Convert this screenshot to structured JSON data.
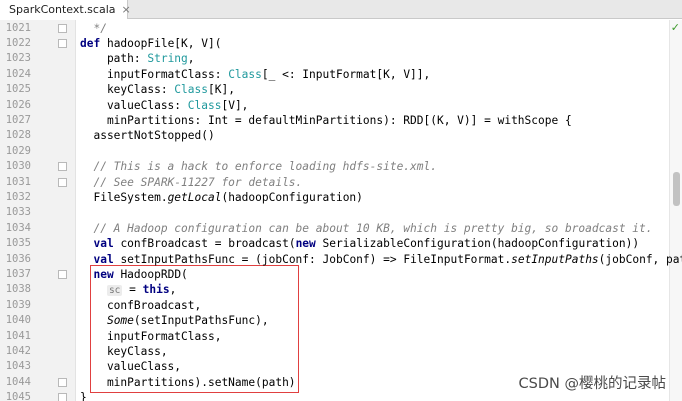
{
  "editor": {
    "tab": {
      "filename": "SparkContext.scala",
      "close": "×"
    },
    "status_check": "✓",
    "watermark": "CSDN @樱桃的记录帖"
  },
  "lines": [
    {
      "n": "1021",
      "fold": true,
      "segs": [
        {
          "t": "  */",
          "c": "cm"
        }
      ]
    },
    {
      "n": "1022",
      "fold": true,
      "segs": [
        {
          "t": "def",
          "c": "kw"
        },
        {
          "t": " hadoopFile[K, V]("
        }
      ]
    },
    {
      "n": "1023",
      "fold": false,
      "segs": [
        {
          "t": "    path: "
        },
        {
          "t": "String",
          "c": "tp"
        },
        {
          "t": ","
        }
      ]
    },
    {
      "n": "1024",
      "fold": false,
      "segs": [
        {
          "t": "    inputFormatClass: "
        },
        {
          "t": "Class",
          "c": "tp"
        },
        {
          "t": "[_ <: InputFormat[K, V]],"
        }
      ]
    },
    {
      "n": "1025",
      "fold": false,
      "segs": [
        {
          "t": "    keyClass: "
        },
        {
          "t": "Class",
          "c": "tp"
        },
        {
          "t": "[K],"
        }
      ]
    },
    {
      "n": "1026",
      "fold": false,
      "segs": [
        {
          "t": "    valueClass: "
        },
        {
          "t": "Class",
          "c": "tp"
        },
        {
          "t": "[V],"
        }
      ]
    },
    {
      "n": "1027",
      "fold": false,
      "segs": [
        {
          "t": "    minPartitions: Int = defaultMinPartitions): RDD[(K, V)] = withScope {"
        }
      ]
    },
    {
      "n": "1028",
      "fold": false,
      "segs": [
        {
          "t": "  assertNotStopped()"
        }
      ]
    },
    {
      "n": "1029",
      "fold": false,
      "segs": [
        {
          "t": ""
        }
      ]
    },
    {
      "n": "1030",
      "fold": true,
      "segs": [
        {
          "t": "  // This is a hack to enforce loading hdfs-site.xml.",
          "c": "cm"
        }
      ]
    },
    {
      "n": "1031",
      "fold": true,
      "segs": [
        {
          "t": "  // See SPARK-11227 for details.",
          "c": "cm"
        }
      ]
    },
    {
      "n": "1032",
      "fold": false,
      "segs": [
        {
          "t": "  FileSystem."
        },
        {
          "t": "getLocal",
          "c": "it"
        },
        {
          "t": "(hadoopConfiguration)"
        }
      ]
    },
    {
      "n": "1033",
      "fold": false,
      "segs": [
        {
          "t": ""
        }
      ]
    },
    {
      "n": "1034",
      "fold": false,
      "segs": [
        {
          "t": "  // A Hadoop configuration can be about 10 KB, which is pretty big, so broadcast it.",
          "c": "cm"
        }
      ]
    },
    {
      "n": "1035",
      "fold": false,
      "segs": [
        {
          "t": "  "
        },
        {
          "t": "val",
          "c": "kw"
        },
        {
          "t": " confBroadcast = broadcast("
        },
        {
          "t": "new",
          "c": "kw"
        },
        {
          "t": " SerializableConfiguration(hadoopConfiguration))"
        }
      ]
    },
    {
      "n": "1036",
      "fold": false,
      "segs": [
        {
          "t": "  "
        },
        {
          "t": "val",
          "c": "kw"
        },
        {
          "t": " setInputPathsFunc = (jobConf: JobConf) => FileInputFormat."
        },
        {
          "t": "setInputPaths",
          "c": "it"
        },
        {
          "t": "(jobConf, path)"
        }
      ]
    },
    {
      "n": "1037",
      "fold": true,
      "segs": [
        {
          "t": "  "
        },
        {
          "t": "new",
          "c": "kw"
        },
        {
          "t": " HadoopRDD("
        }
      ]
    },
    {
      "n": "1038",
      "fold": false,
      "segs": [
        {
          "t": "    "
        },
        {
          "t": "sc",
          "c": "inlay"
        },
        {
          "t": " = "
        },
        {
          "t": "this",
          "c": "kw"
        },
        {
          "t": ","
        }
      ]
    },
    {
      "n": "1039",
      "fold": false,
      "segs": [
        {
          "t": "    confBroadcast,"
        }
      ]
    },
    {
      "n": "1040",
      "fold": false,
      "segs": [
        {
          "t": "    "
        },
        {
          "t": "Some",
          "c": "it"
        },
        {
          "t": "(setInputPathsFunc),"
        }
      ]
    },
    {
      "n": "1041",
      "fold": false,
      "segs": [
        {
          "t": "    inputFormatClass,"
        }
      ]
    },
    {
      "n": "1042",
      "fold": false,
      "segs": [
        {
          "t": "    keyClass,"
        }
      ]
    },
    {
      "n": "1043",
      "fold": false,
      "segs": [
        {
          "t": "    valueClass,"
        }
      ]
    },
    {
      "n": "1044",
      "fold": true,
      "segs": [
        {
          "t": "    minPartitions).setName(path)"
        }
      ]
    },
    {
      "n": "1045",
      "fold": true,
      "segs": [
        {
          "t": "}"
        }
      ]
    }
  ]
}
